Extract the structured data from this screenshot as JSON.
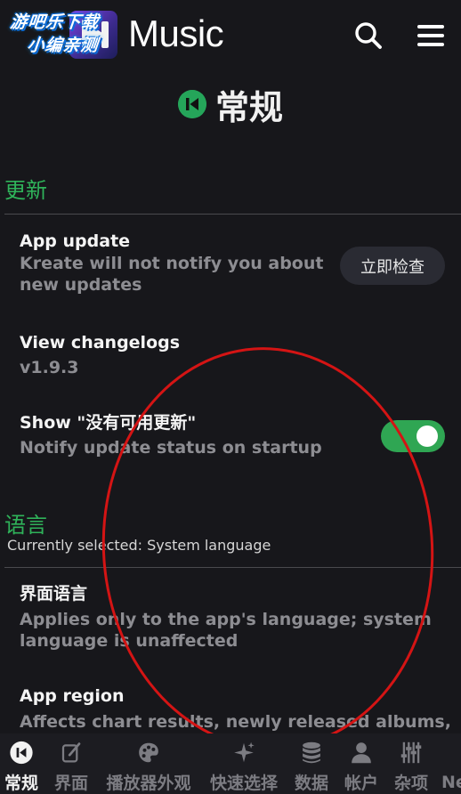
{
  "header": {
    "watermark_line1": "游吧乐下载",
    "watermark_line2": "小编亲测",
    "app_name": "Music"
  },
  "page": {
    "title": "常规"
  },
  "sections": {
    "update": {
      "heading": "更新",
      "app_update": {
        "title": "App update",
        "desc": "Kreate will not notify you about new updates",
        "button": "立即检查"
      },
      "changelogs": {
        "title": "View changelogs",
        "version": "v1.9.3"
      },
      "no_update": {
        "title": "Show \"没有可用更新\"",
        "desc": "Notify update status on startup",
        "enabled": true
      }
    },
    "language": {
      "heading": "语言",
      "current": "Currently selected: System language",
      "ui_language": {
        "title": "界面语言",
        "desc": "Applies only to the app's language; system language is unaffected"
      },
      "region": {
        "title": "App region",
        "desc": "Affects chart results, newly released albums,"
      }
    }
  },
  "bottom_nav": [
    {
      "label": "常规",
      "icon": "general-icon"
    },
    {
      "label": "界面",
      "icon": "edit-icon"
    },
    {
      "label": "播放器外观",
      "icon": "palette-icon"
    },
    {
      "label": "快速选择",
      "icon": "sparkle-icon"
    },
    {
      "label": "数据",
      "icon": "database-icon"
    },
    {
      "label": "帐户",
      "icon": "person-icon"
    },
    {
      "label": "杂项",
      "icon": "sliders-icon"
    },
    {
      "label": "Ne",
      "icon": "more-icon"
    }
  ],
  "colors": {
    "accent": "#2fb35a",
    "background": "#17171b",
    "annotation": "#d41414"
  }
}
